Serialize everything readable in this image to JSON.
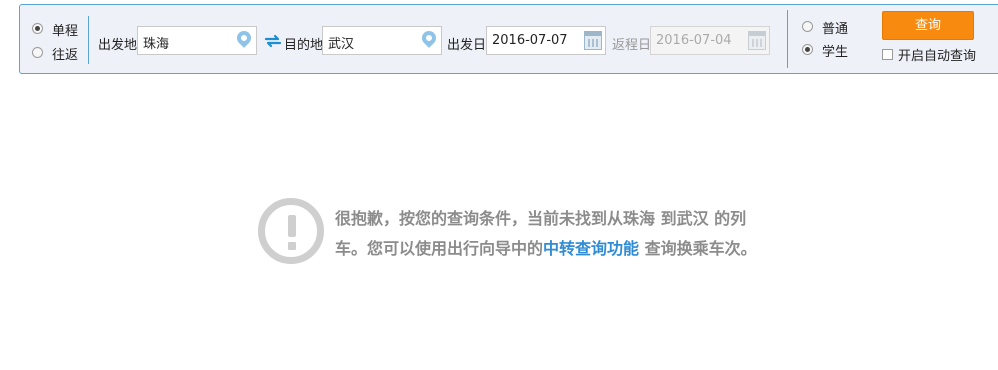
{
  "trip_type": {
    "one_way": "单程",
    "round_trip": "往返",
    "selected": "one_way"
  },
  "from": {
    "label": "出发地",
    "value": "珠海"
  },
  "to": {
    "label": "目的地",
    "value": "武汉"
  },
  "depart_date": {
    "label": "出发日",
    "value": "2016-07-07"
  },
  "return_date": {
    "label": "返程日",
    "value": "2016-07-04"
  },
  "passenger_type": {
    "normal": "普通",
    "student": "学生",
    "selected": "student"
  },
  "search_button": "查询",
  "auto_query_label": "开启自动查询",
  "notice": {
    "text_before": "很抱歉，按您的查询条件，当前未找到从珠海 到武汉 的列车。您可以使用出行向导中的",
    "link": "中转查询功能",
    "text_after": " 查询换乘车次。"
  },
  "colors": {
    "accent": "#5ba3d9",
    "button": "#f78a0f",
    "link": "#2f8cd5"
  }
}
